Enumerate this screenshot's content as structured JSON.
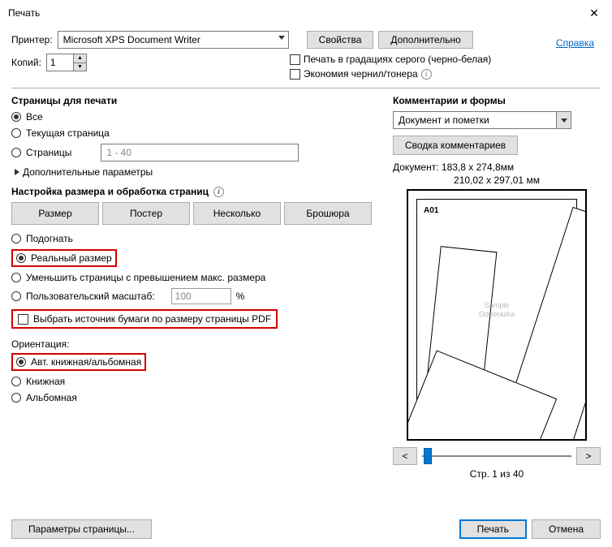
{
  "titlebar": {
    "title": "Печать"
  },
  "top": {
    "printer_label": "Принтер:",
    "printer_value": "Microsoft XPS Document Writer",
    "props_btn": "Свойства",
    "advanced_btn": "Дополнительно",
    "help_link": "Справка",
    "copies_label": "Копий:",
    "copies_value": "1",
    "grayscale_label": "Печать в градациях серого (черно-белая)",
    "ink_label": "Экономия чернил/тонера"
  },
  "pages": {
    "heading": "Страницы для печати",
    "all": "Все",
    "current": "Текущая страница",
    "range": "Страницы",
    "range_value": "1 - 40",
    "more": "Дополнительные параметры"
  },
  "sizing": {
    "heading": "Настройка размера и обработка страниц",
    "tabs": {
      "size": "Размер",
      "poster": "Постер",
      "multi": "Несколько",
      "booklet": "Брошюра"
    },
    "fit": "Подогнать",
    "actual": "Реальный размер",
    "shrink": "Уменьшить страницы с превышением макс. размера",
    "custom": "Пользовательский масштаб:",
    "custom_value": "100",
    "percent": "%",
    "papersource": "Выбрать источник бумаги по размеру страницы PDF"
  },
  "orientation": {
    "heading": "Ориентация:",
    "auto": "Авт. книжная/альбомная",
    "portrait": "Книжная",
    "landscape": "Альбомная"
  },
  "comments": {
    "heading": "Комментарии и формы",
    "combo_value": "Документ и пометки",
    "summary_btn": "Сводка комментариев"
  },
  "preview": {
    "doc_dim": "Документ: 183,8 x 274,8мм",
    "page_dim": "210,02 x 297,01 мм",
    "sheet_label": "A01",
    "page_indicator": "Стр. 1 из 40"
  },
  "footer": {
    "page_setup": "Параметры страницы...",
    "print": "Печать",
    "cancel": "Отмена"
  }
}
